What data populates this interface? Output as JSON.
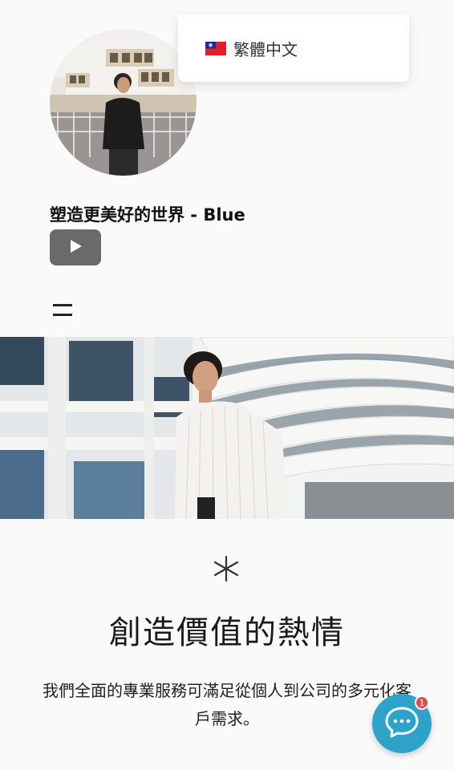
{
  "language_selector": {
    "label": "繁體中文",
    "flag_icon": "taiwan-flag-icon"
  },
  "profile": {
    "title": "塑造更美好的世界 - Blue"
  },
  "social": {
    "youtube_icon": "play-icon",
    "button_color": "#6a6a6a"
  },
  "nav": {
    "menu_icon": "hamburger-menu-icon"
  },
  "section": {
    "decorative_icon": "asterisk-icon",
    "heading": "創造價值的熱情",
    "body": "我們全面的專業服務可滿足從個人到公司的多元化客戶需求。"
  },
  "chat": {
    "icon": "chat-bubble-icon",
    "badge_count": "1",
    "accent_color": "#2ea3c9",
    "badge_color": "#e5484d"
  }
}
